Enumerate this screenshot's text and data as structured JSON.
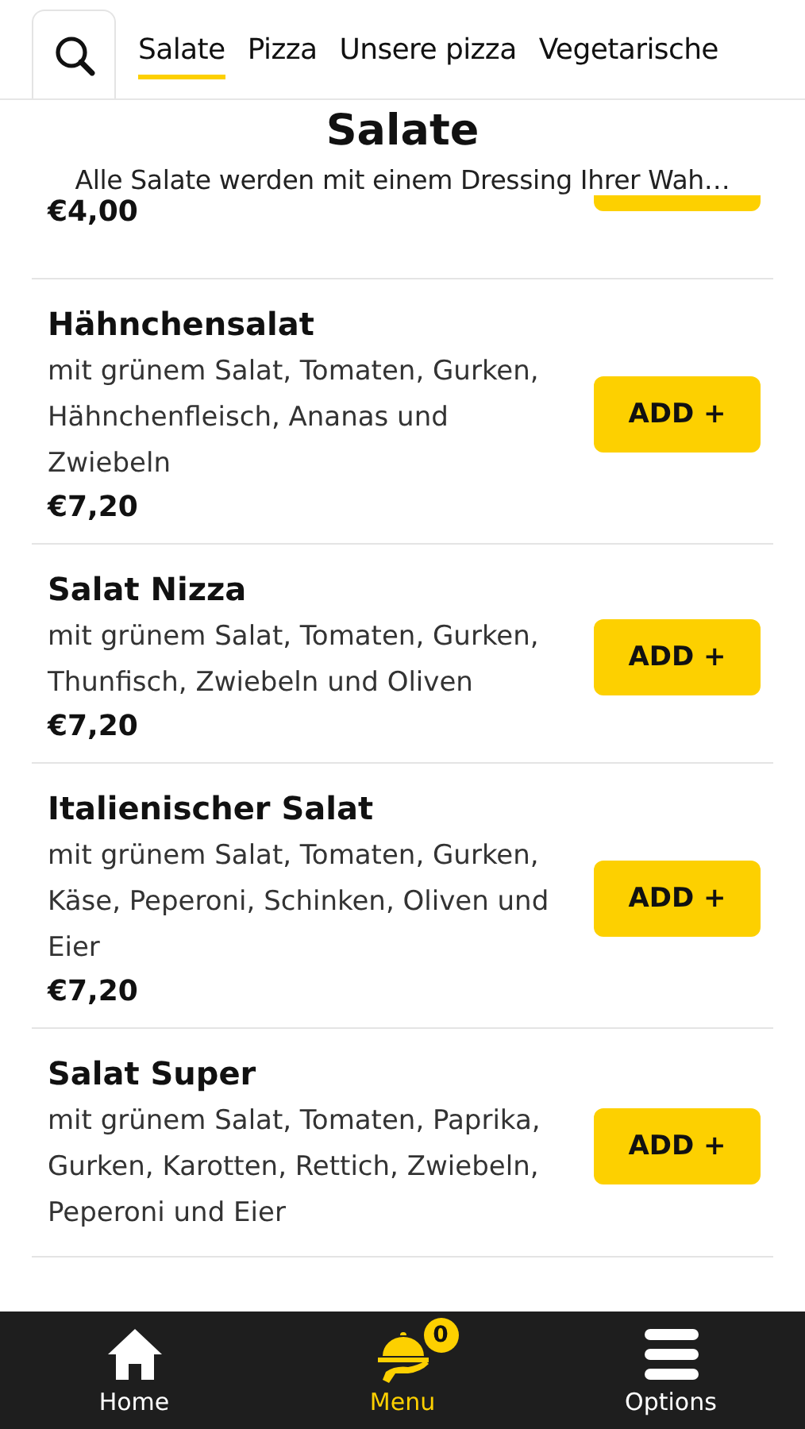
{
  "tabs": [
    {
      "label": "Salate",
      "selected": true
    },
    {
      "label": "Pizza",
      "selected": false
    },
    {
      "label": "Unsere pizza",
      "selected": false
    },
    {
      "label": "Vegetarische",
      "selected": false
    }
  ],
  "section": {
    "title": "Salate",
    "subtitle": "Alle Salate werden mit einem Dressing Ihrer Wah…"
  },
  "items": [
    {
      "kind": "partial",
      "price": "€4,00"
    },
    {
      "kind": "full",
      "name": "Hähnchensalat",
      "description": "mit grünem Salat, Tomaten, Gurken, Hähnchenfleisch, Ananas und Zwiebeln",
      "price": "€7,20",
      "button": "ADD +"
    },
    {
      "kind": "full",
      "name": "Salat Nizza",
      "description": "mit grünem Salat, Tomaten, Gurken, Thunfisch, Zwiebeln und Oliven",
      "price": "€7,20",
      "button": "ADD +"
    },
    {
      "kind": "full",
      "name": "Italienischer Salat",
      "description": "mit grünem Salat, Tomaten, Gurken, Käse, Peperoni, Schinken, Oliven und Eier",
      "price": "€7,20",
      "button": "ADD +"
    },
    {
      "kind": "full",
      "name": "Salat Super",
      "description": "mit grünem Salat, Tomaten, Paprika, Gurken, Karotten, Rettich, Zwiebeln, Peperoni und Eier",
      "button": "ADD +"
    }
  ],
  "nav": [
    {
      "kind": "home",
      "label": "Home",
      "selected": false
    },
    {
      "kind": "menu",
      "label": "Menu",
      "selected": true,
      "badge": "0"
    },
    {
      "kind": "options",
      "label": "Options",
      "selected": false
    }
  ]
}
